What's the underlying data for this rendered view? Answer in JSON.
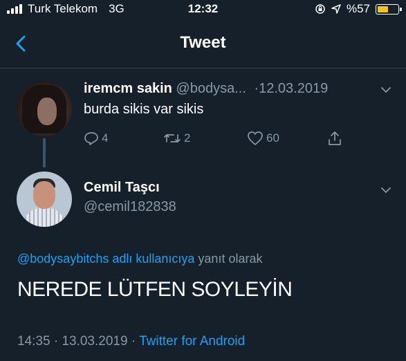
{
  "status_bar": {
    "carrier": "Turk Telekom",
    "network": "3G",
    "time": "12:32",
    "battery_text": "%57",
    "battery_level": 0.57
  },
  "nav": {
    "title": "Tweet"
  },
  "tweet": {
    "name": "iremcm sakin",
    "handle": "@bodysa...",
    "separator": "·",
    "date": "12.03.2019",
    "text": "burda sikis var sikis",
    "replies": "4",
    "retweets": "2",
    "likes": "60"
  },
  "reply_tweet": {
    "name": "Cemil Taşcı",
    "handle": "@cemil182838",
    "reply_to_user": "@bodysaybitchs adlı kullanıcıya",
    "reply_to_suffix": "yanıt olarak",
    "text": "NEREDE LÜTFEN SOYLEYİN",
    "time": "14:35",
    "separator1": "·",
    "date": "13.03.2019",
    "separator2": "·",
    "source": "Twitter for Android"
  },
  "colors": {
    "background": "#15202b",
    "accent": "#1da1f2",
    "muted": "#8899a6",
    "battery": "#f5c518"
  }
}
